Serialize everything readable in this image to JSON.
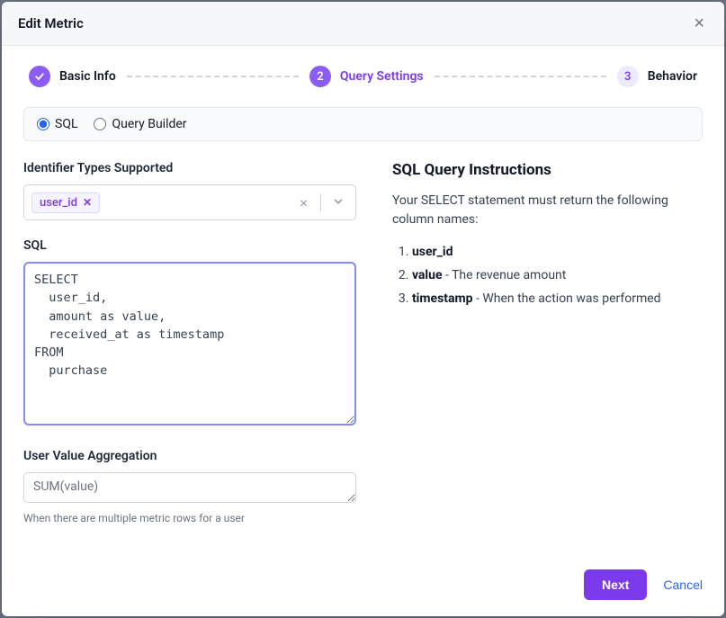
{
  "modal": {
    "title": "Edit Metric"
  },
  "stepper": {
    "step1": {
      "label": "Basic Info"
    },
    "step2": {
      "num": "2",
      "label": "Query Settings"
    },
    "step3": {
      "num": "3",
      "label": "Behavior"
    }
  },
  "queryMode": {
    "sql": "SQL",
    "builder": "Query Builder"
  },
  "identifier": {
    "label": "Identifier Types Supported",
    "tag": "user_id"
  },
  "sql": {
    "label": "SQL",
    "value": "SELECT\n  user_id,\n  amount as value,\n  received_at as timestamp\nFROM\n  purchase"
  },
  "aggregation": {
    "label": "User Value Aggregation",
    "value": "SUM(value)",
    "help": "When there are multiple metric rows for a user"
  },
  "instructions": {
    "title": "SQL Query Instructions",
    "intro": "Your SELECT statement must return the following column names:",
    "col1": "user_id",
    "col2": "value",
    "col2_desc": " - The revenue amount",
    "col3": "timestamp",
    "col3_desc": " - When the action was performed"
  },
  "footer": {
    "next": "Next",
    "cancel": "Cancel"
  }
}
